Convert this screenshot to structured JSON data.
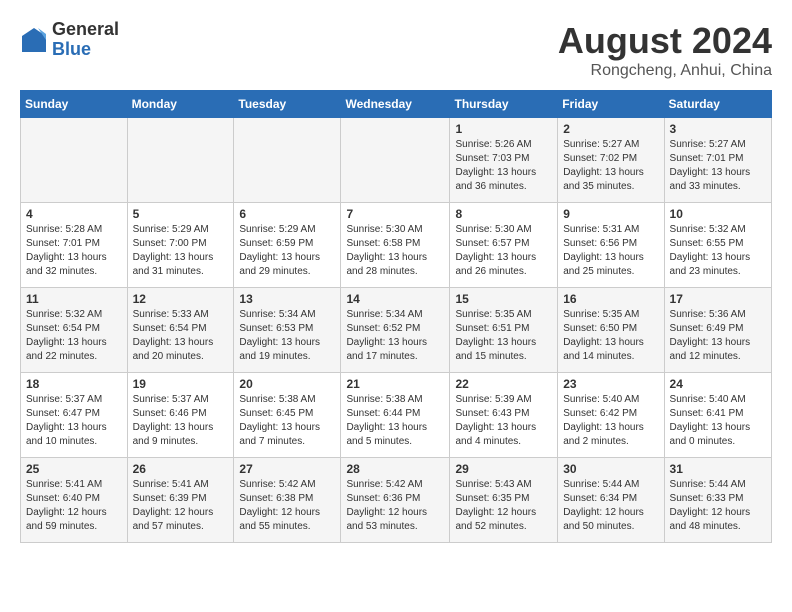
{
  "header": {
    "logo": {
      "general": "General",
      "blue": "Blue"
    },
    "month_year": "August 2024",
    "location": "Rongcheng, Anhui, China"
  },
  "days_of_week": [
    "Sunday",
    "Monday",
    "Tuesday",
    "Wednesday",
    "Thursday",
    "Friday",
    "Saturday"
  ],
  "weeks": [
    {
      "days": [
        {
          "number": "",
          "info": ""
        },
        {
          "number": "",
          "info": ""
        },
        {
          "number": "",
          "info": ""
        },
        {
          "number": "",
          "info": ""
        },
        {
          "number": "1",
          "info": "Sunrise: 5:26 AM\nSunset: 7:03 PM\nDaylight: 13 hours\nand 36 minutes."
        },
        {
          "number": "2",
          "info": "Sunrise: 5:27 AM\nSunset: 7:02 PM\nDaylight: 13 hours\nand 35 minutes."
        },
        {
          "number": "3",
          "info": "Sunrise: 5:27 AM\nSunset: 7:01 PM\nDaylight: 13 hours\nand 33 minutes."
        }
      ]
    },
    {
      "days": [
        {
          "number": "4",
          "info": "Sunrise: 5:28 AM\nSunset: 7:01 PM\nDaylight: 13 hours\nand 32 minutes."
        },
        {
          "number": "5",
          "info": "Sunrise: 5:29 AM\nSunset: 7:00 PM\nDaylight: 13 hours\nand 31 minutes."
        },
        {
          "number": "6",
          "info": "Sunrise: 5:29 AM\nSunset: 6:59 PM\nDaylight: 13 hours\nand 29 minutes."
        },
        {
          "number": "7",
          "info": "Sunrise: 5:30 AM\nSunset: 6:58 PM\nDaylight: 13 hours\nand 28 minutes."
        },
        {
          "number": "8",
          "info": "Sunrise: 5:30 AM\nSunset: 6:57 PM\nDaylight: 13 hours\nand 26 minutes."
        },
        {
          "number": "9",
          "info": "Sunrise: 5:31 AM\nSunset: 6:56 PM\nDaylight: 13 hours\nand 25 minutes."
        },
        {
          "number": "10",
          "info": "Sunrise: 5:32 AM\nSunset: 6:55 PM\nDaylight: 13 hours\nand 23 minutes."
        }
      ]
    },
    {
      "days": [
        {
          "number": "11",
          "info": "Sunrise: 5:32 AM\nSunset: 6:54 PM\nDaylight: 13 hours\nand 22 minutes."
        },
        {
          "number": "12",
          "info": "Sunrise: 5:33 AM\nSunset: 6:54 PM\nDaylight: 13 hours\nand 20 minutes."
        },
        {
          "number": "13",
          "info": "Sunrise: 5:34 AM\nSunset: 6:53 PM\nDaylight: 13 hours\nand 19 minutes."
        },
        {
          "number": "14",
          "info": "Sunrise: 5:34 AM\nSunset: 6:52 PM\nDaylight: 13 hours\nand 17 minutes."
        },
        {
          "number": "15",
          "info": "Sunrise: 5:35 AM\nSunset: 6:51 PM\nDaylight: 13 hours\nand 15 minutes."
        },
        {
          "number": "16",
          "info": "Sunrise: 5:35 AM\nSunset: 6:50 PM\nDaylight: 13 hours\nand 14 minutes."
        },
        {
          "number": "17",
          "info": "Sunrise: 5:36 AM\nSunset: 6:49 PM\nDaylight: 13 hours\nand 12 minutes."
        }
      ]
    },
    {
      "days": [
        {
          "number": "18",
          "info": "Sunrise: 5:37 AM\nSunset: 6:47 PM\nDaylight: 13 hours\nand 10 minutes."
        },
        {
          "number": "19",
          "info": "Sunrise: 5:37 AM\nSunset: 6:46 PM\nDaylight: 13 hours\nand 9 minutes."
        },
        {
          "number": "20",
          "info": "Sunrise: 5:38 AM\nSunset: 6:45 PM\nDaylight: 13 hours\nand 7 minutes."
        },
        {
          "number": "21",
          "info": "Sunrise: 5:38 AM\nSunset: 6:44 PM\nDaylight: 13 hours\nand 5 minutes."
        },
        {
          "number": "22",
          "info": "Sunrise: 5:39 AM\nSunset: 6:43 PM\nDaylight: 13 hours\nand 4 minutes."
        },
        {
          "number": "23",
          "info": "Sunrise: 5:40 AM\nSunset: 6:42 PM\nDaylight: 13 hours\nand 2 minutes."
        },
        {
          "number": "24",
          "info": "Sunrise: 5:40 AM\nSunset: 6:41 PM\nDaylight: 13 hours\nand 0 minutes."
        }
      ]
    },
    {
      "days": [
        {
          "number": "25",
          "info": "Sunrise: 5:41 AM\nSunset: 6:40 PM\nDaylight: 12 hours\nand 59 minutes."
        },
        {
          "number": "26",
          "info": "Sunrise: 5:41 AM\nSunset: 6:39 PM\nDaylight: 12 hours\nand 57 minutes."
        },
        {
          "number": "27",
          "info": "Sunrise: 5:42 AM\nSunset: 6:38 PM\nDaylight: 12 hours\nand 55 minutes."
        },
        {
          "number": "28",
          "info": "Sunrise: 5:42 AM\nSunset: 6:36 PM\nDaylight: 12 hours\nand 53 minutes."
        },
        {
          "number": "29",
          "info": "Sunrise: 5:43 AM\nSunset: 6:35 PM\nDaylight: 12 hours\nand 52 minutes."
        },
        {
          "number": "30",
          "info": "Sunrise: 5:44 AM\nSunset: 6:34 PM\nDaylight: 12 hours\nand 50 minutes."
        },
        {
          "number": "31",
          "info": "Sunrise: 5:44 AM\nSunset: 6:33 PM\nDaylight: 12 hours\nand 48 minutes."
        }
      ]
    }
  ]
}
